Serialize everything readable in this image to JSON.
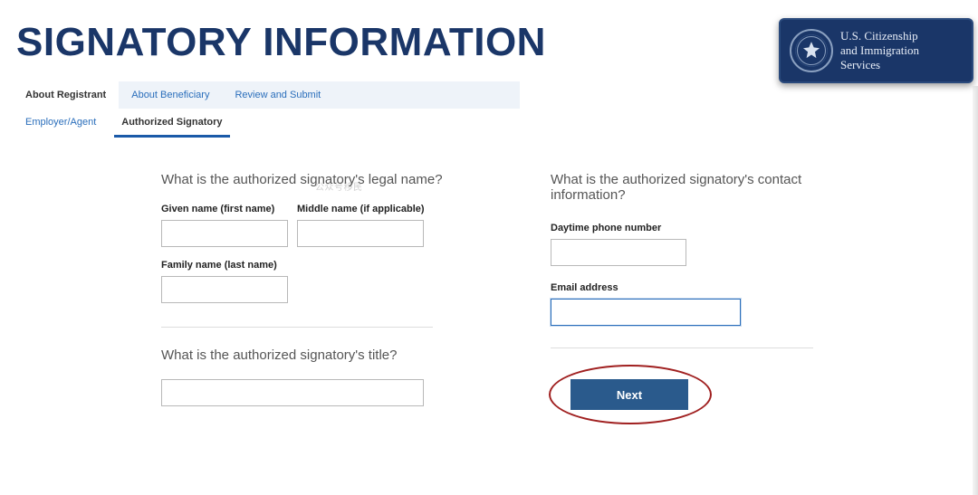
{
  "header": {
    "title": "SIGNATORY INFORMATION",
    "agency_line1": "U.S. Citizenship",
    "agency_line2": "and Immigration",
    "agency_line3": "Services"
  },
  "tabs": {
    "primary": [
      {
        "label": "About Registrant",
        "active": true
      },
      {
        "label": "About Beneficiary",
        "active": false
      },
      {
        "label": "Review and Submit",
        "active": false
      }
    ],
    "secondary": [
      {
        "label": "Employer/Agent",
        "active": false
      },
      {
        "label": "Authorized Signatory",
        "active": true
      }
    ]
  },
  "left": {
    "name_question": "What is the authorized signatory's legal name?",
    "given_label": "Given name (first name)",
    "middle_label": "Middle name (if applicable)",
    "family_label": "Family name (last name)",
    "given_value": "",
    "middle_value": "",
    "family_value": "",
    "title_question": "What is the authorized signatory's title?",
    "title_value": ""
  },
  "right": {
    "contact_question": "What is the authorized signatory's contact information?",
    "phone_label": "Daytime phone number",
    "phone_value": "",
    "email_label": "Email address",
    "email_value": "",
    "next_label": "Next"
  },
  "watermark": "公众号移民"
}
